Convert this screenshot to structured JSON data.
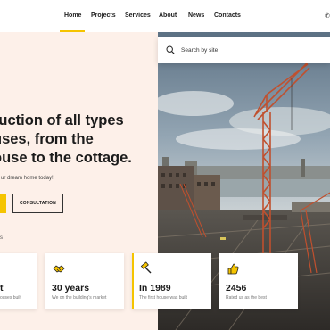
{
  "nav": {
    "items": [
      "Home",
      "Projects",
      "Services",
      "About",
      "News",
      "Contacts"
    ],
    "active": "Home",
    "accent_color": "#f5c400"
  },
  "search": {
    "placeholder": "Search by site",
    "icon": "search-icon"
  },
  "hero": {
    "headline_lines": [
      "ruction of all types",
      "uses, from the",
      "ouse to the cottage."
    ],
    "subtitle": "ur dream home today!",
    "consultation_label": "CONSULTATION",
    "scroll_label": "s",
    "background_color": "#fdf0e9"
  },
  "stats": [
    {
      "icon": "house-icon",
      "value": "t",
      "desc": "ouses built"
    },
    {
      "icon": "handshake-icon",
      "value": "30 years",
      "desc": "We on the building's market"
    },
    {
      "icon": "hammer-icon",
      "value": "In 1989",
      "desc": "The first house was built"
    },
    {
      "icon": "thumbs-up-icon",
      "value": "2456",
      "desc": "Rated us as the best"
    }
  ]
}
